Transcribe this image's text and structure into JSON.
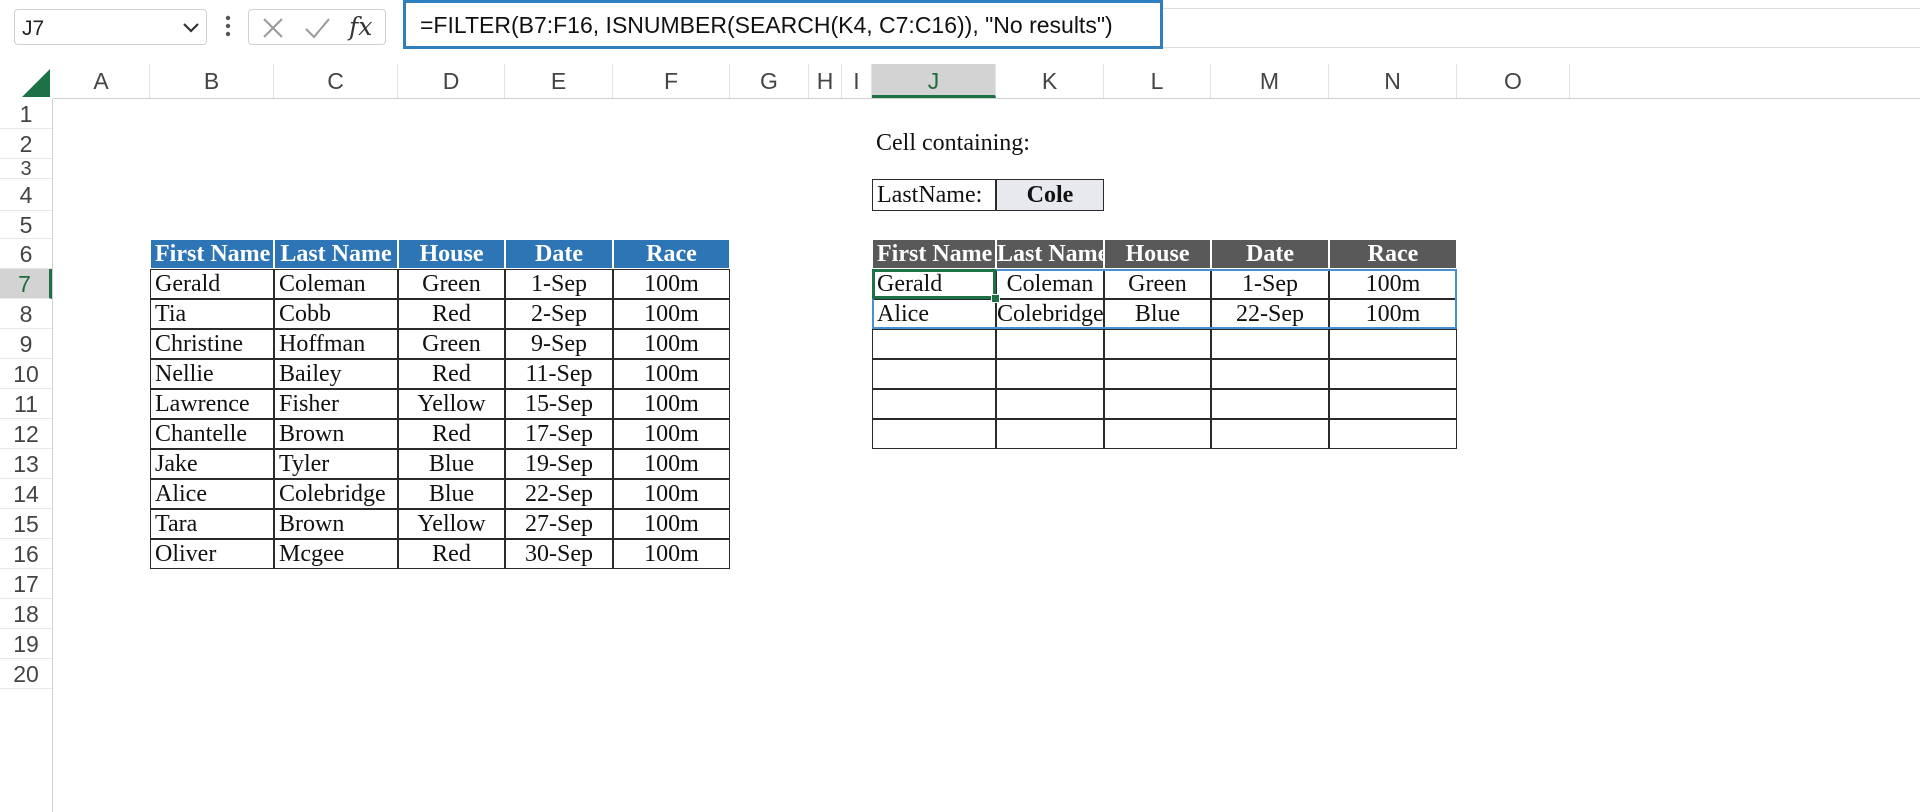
{
  "name_box": "J7",
  "formula": "=FILTER(B7:F16, ISNUMBER(SEARCH(K4, C7:C16)), \"No results\")",
  "fx_label": "fx",
  "columns": [
    "A",
    "B",
    "C",
    "D",
    "E",
    "F",
    "G",
    "H",
    "I",
    "J",
    "K",
    "L",
    "M",
    "N",
    "O"
  ],
  "rows": [
    "1",
    "2",
    "3",
    "4",
    "5",
    "6",
    "7",
    "8",
    "9",
    "10",
    "11",
    "12",
    "13",
    "14",
    "15",
    "16",
    "17",
    "18",
    "19",
    "20"
  ],
  "active_cell": {
    "column": "J",
    "row": "7"
  },
  "source_table": {
    "headers": [
      "First Name",
      "Last Name",
      "House",
      "Date",
      "Race"
    ],
    "rows": [
      [
        "Gerald",
        "Coleman",
        "Green",
        "1-Sep",
        "100m"
      ],
      [
        "Tia",
        "Cobb",
        "Red",
        "2-Sep",
        "100m"
      ],
      [
        "Christine",
        "Hoffman",
        "Green",
        "9-Sep",
        "100m"
      ],
      [
        "Nellie",
        "Bailey",
        "Red",
        "11-Sep",
        "100m"
      ],
      [
        "Lawrence",
        "Fisher",
        "Yellow",
        "15-Sep",
        "100m"
      ],
      [
        "Chantelle",
        "Brown",
        "Red",
        "17-Sep",
        "100m"
      ],
      [
        "Jake",
        "Tyler",
        "Blue",
        "19-Sep",
        "100m"
      ],
      [
        "Alice",
        "Colebridge",
        "Blue",
        "22-Sep",
        "100m"
      ],
      [
        "Tara",
        "Brown",
        "Yellow",
        "27-Sep",
        "100m"
      ],
      [
        "Oliver",
        "Mcgee",
        "Red",
        "30-Sep",
        "100m"
      ]
    ]
  },
  "criteria": {
    "title": "Cell containing:",
    "label": "LastName:",
    "value": "Cole"
  },
  "result_table": {
    "headers": [
      "First Name",
      "Last Name",
      "House",
      "Date",
      "Race"
    ],
    "rows": [
      [
        "Gerald",
        "Coleman",
        "Green",
        "1-Sep",
        "100m"
      ],
      [
        "Alice",
        "Colebridge",
        "Blue",
        "22-Sep",
        "100m"
      ],
      [
        "",
        "",
        "",
        "",
        ""
      ],
      [
        "",
        "",
        "",
        "",
        ""
      ],
      [
        "",
        "",
        "",
        "",
        ""
      ],
      [
        "",
        "",
        "",
        "",
        ""
      ]
    ]
  },
  "colors": {
    "source_header": "#2e75b6",
    "result_header": "#595959",
    "active_accent": "#1e7145",
    "formula_border": "#2f7fbf"
  }
}
